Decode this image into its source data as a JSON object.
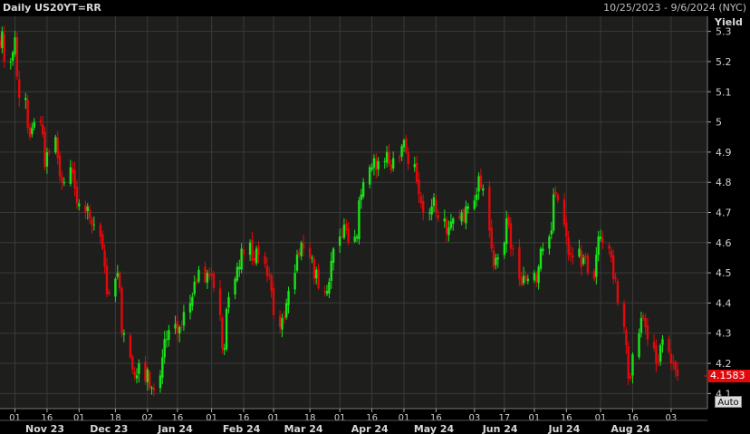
{
  "header": {
    "title": "Daily US20YT=RR",
    "date_range": "10/25/2023 - 9/6/2024 (NYC)"
  },
  "axis": {
    "y_title": "Yield",
    "auto_label": "Auto",
    "last_value": "4.1583"
  },
  "colors": {
    "up": "#19e319",
    "down": "#e3080b",
    "background": "#1e1f1d",
    "grid": "#3a3b38"
  },
  "chart_data": {
    "type": "candlestick",
    "title": "Daily US20YT=RR",
    "ylabel": "Yield",
    "ylim": [
      4.05,
      5.35
    ],
    "y_ticks": [
      4.1,
      4.2,
      4.3,
      4.4,
      4.5,
      4.6,
      4.7,
      4.8,
      4.9,
      5.0,
      5.1,
      5.2,
      5.3
    ],
    "y_tick_labels": [
      "4.1",
      "4.2",
      "4.3",
      "4.4",
      "4.5",
      "4.6",
      "4.7",
      "4.8",
      "4.9",
      "5",
      "5.1",
      "5.2",
      "5.3"
    ],
    "x_day_ticks": [
      {
        "label": "01",
        "date": "2023-11-01"
      },
      {
        "label": "16",
        "date": "2023-11-16"
      },
      {
        "label": "01",
        "date": "2023-12-01"
      },
      {
        "label": "18",
        "date": "2023-12-18"
      },
      {
        "label": "02",
        "date": "2024-01-02"
      },
      {
        "label": "16",
        "date": "2024-01-16"
      },
      {
        "label": "01",
        "date": "2024-02-01"
      },
      {
        "label": "16",
        "date": "2024-02-16"
      },
      {
        "label": "01",
        "date": "2024-03-01"
      },
      {
        "label": "18",
        "date": "2024-03-18"
      },
      {
        "label": "01",
        "date": "2024-04-01"
      },
      {
        "label": "16",
        "date": "2024-04-16"
      },
      {
        "label": "01",
        "date": "2024-05-01"
      },
      {
        "label": "16",
        "date": "2024-05-16"
      },
      {
        "label": "03",
        "date": "2024-06-03"
      },
      {
        "label": "17",
        "date": "2024-06-17"
      },
      {
        "label": "01",
        "date": "2024-07-01"
      },
      {
        "label": "16",
        "date": "2024-07-16"
      },
      {
        "label": "01",
        "date": "2024-08-01"
      },
      {
        "label": "16",
        "date": "2024-08-16"
      },
      {
        "label": "03",
        "date": "2024-09-03"
      }
    ],
    "x_month_labels": [
      {
        "label": "Nov 23",
        "date": "2023-11-15"
      },
      {
        "label": "Dec 23",
        "date": "2023-12-15"
      },
      {
        "label": "Jan 24",
        "date": "2024-01-15"
      },
      {
        "label": "Feb 24",
        "date": "2024-02-15"
      },
      {
        "label": "Mar 24",
        "date": "2024-03-15"
      },
      {
        "label": "Apr 24",
        "date": "2024-04-15"
      },
      {
        "label": "May 24",
        "date": "2024-05-15"
      },
      {
        "label": "Jun 24",
        "date": "2024-06-15"
      },
      {
        "label": "Jul 24",
        "date": "2024-07-15"
      },
      {
        "label": "Aug 24",
        "date": "2024-08-15"
      }
    ],
    "x_range": [
      "2023-10-25",
      "2024-09-06"
    ],
    "last_close": 4.1583,
    "closes": [
      [
        5.25,
        5.3,
        5.2,
        5.23,
        5.28,
        5.15,
        5.08,
        4.98,
        4.95,
        4.98,
        5.0
      ],
      [
        4.96,
        4.85,
        4.9,
        4.95,
        4.88,
        4.82,
        4.8,
        4.85,
        4.83,
        4.78,
        4.73,
        4.7,
        4.72,
        4.68,
        4.66,
        4.62,
        4.58,
        4.52,
        4.43,
        4.48,
        4.5,
        4.45
      ],
      [
        4.3,
        4.22,
        4.18,
        4.16,
        4.2,
        4.14,
        4.18,
        4.12,
        4.11,
        4.16,
        4.22,
        4.28,
        4.31,
        4.33,
        4.3,
        4.32,
        4.37,
        4.4,
        4.42,
        4.47,
        4.51
      ],
      [
        4.47,
        4.5,
        4.49,
        4.45,
        4.36,
        4.25,
        4.38,
        4.42,
        4.48,
        4.52,
        4.58,
        4.56,
        4.6,
        4.54,
        4.58,
        4.56,
        4.53,
        4.49,
        4.44,
        4.36
      ],
      [
        4.32,
        4.35,
        4.4,
        4.44,
        4.5,
        4.56,
        4.6,
        4.58,
        4.55,
        4.48,
        4.51,
        4.45,
        4.44,
        4.47,
        4.54,
        4.58,
        4.62,
        4.66,
        4.64,
        4.6,
        4.62
      ],
      [
        4.74,
        4.76,
        4.8,
        4.85,
        4.88,
        4.84,
        4.87,
        4.9,
        4.86,
        4.84,
        4.88,
        4.92,
        4.94,
        4.9,
        4.86,
        4.8,
        4.76,
        4.73,
        4.7,
        4.72,
        4.75,
        4.7
      ],
      [
        4.68,
        4.63,
        4.65,
        4.67,
        4.68,
        4.7,
        4.67,
        4.72,
        4.74,
        4.76,
        4.82,
        4.78,
        4.64,
        4.58,
        4.52,
        4.55,
        4.6,
        4.68,
        4.66,
        4.58,
        4.48,
        4.46
      ],
      [
        4.49,
        4.48,
        4.5,
        4.47,
        4.52,
        4.58,
        4.62,
        4.64,
        4.76,
        4.74,
        4.66,
        4.62,
        4.56,
        4.55,
        4.58,
        4.52,
        4.55,
        4.5,
        4.48,
        4.56,
        4.62,
        4.6
      ],
      [
        4.58,
        4.55,
        4.48,
        4.4,
        4.32,
        4.26,
        4.15,
        4.23,
        4.3,
        4.35,
        4.32,
        4.28,
        4.25,
        4.2,
        4.26,
        4.28,
        4.24,
        4.2,
        4.18,
        4.1583
      ]
    ]
  }
}
